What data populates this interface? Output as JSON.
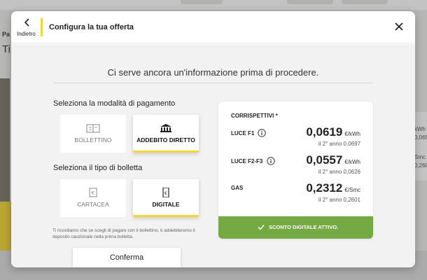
{
  "background": {
    "left_partial_texts": [
      "Pa",
      "Ti"
    ],
    "right_partial_texts": [
      "kWh",
      "0,065",
      "Smc",
      "0,260"
    ]
  },
  "modal": {
    "back_label": "Indietro",
    "title": "Configura la tua offerta",
    "subtitle": "Ci serve ancora un'informazione prima di procedere.",
    "payment": {
      "label": "Seleziona la modalità di pagamento",
      "options": [
        {
          "label": "BOLLETTINO",
          "icon": "bill-icon",
          "selected": false
        },
        {
          "label": "ADDEBITO DIRETTO",
          "icon": "bank-icon",
          "selected": true
        }
      ]
    },
    "bill_type": {
      "label": "Seleziona il tipo di bolletta",
      "options": [
        {
          "label": "CARTACEA",
          "icon": "paper-icon",
          "selected": false
        },
        {
          "label": "DIGITALE",
          "icon": "mobile-icon",
          "selected": true
        }
      ]
    },
    "note": "Ti ricordiamo che se scegli di pagare con il bollettino, ti addebiteremo il deposito cauzionale nella prima bolletta.",
    "confirm_label": "Conferma",
    "prices": {
      "title": "CORRISPETTIVI *",
      "rows": [
        {
          "name": "LUCE F1",
          "value": "0,0619",
          "unit": "€/kWh",
          "second_year": "il 2° anno 0,0697",
          "info": true
        },
        {
          "name": "LUCE F2-F3",
          "value": "0,0557",
          "unit": "€/kWh",
          "second_year": "il 2° anno 0,0626",
          "info": true
        },
        {
          "name": "GAS",
          "value": "0,2312",
          "unit": "€/Smc",
          "second_year": "il 2° anno 0,2601",
          "info": false
        }
      ],
      "discount_label": "SCONTO DIGITALE ATTIVO."
    }
  },
  "colors": {
    "accent_yellow": "#f2d53c",
    "green": "#74a944"
  }
}
